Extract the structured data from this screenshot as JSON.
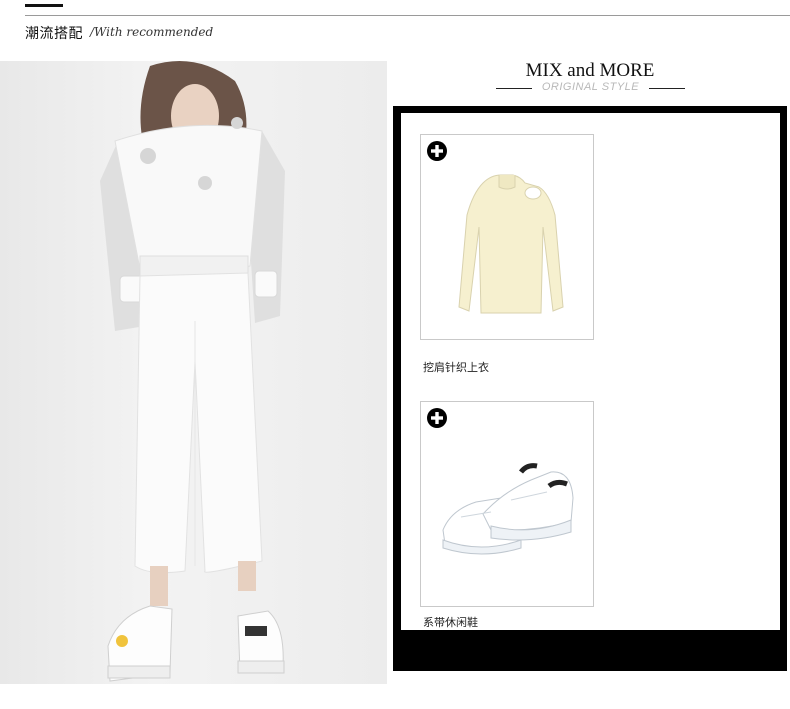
{
  "header": {
    "title": "潮流搭配",
    "subtitle": "/With recommended"
  },
  "mix": {
    "title": "MIX and MORE",
    "subtitle": "ORIGINAL STYLE"
  },
  "products": [
    {
      "label": "挖肩针织上衣",
      "icon": "plus-circle-icon"
    },
    {
      "label": "系带休闲鞋",
      "icon": "plus-circle-icon"
    }
  ],
  "colors": {
    "frame": "#000000",
    "accent": "#111111"
  }
}
